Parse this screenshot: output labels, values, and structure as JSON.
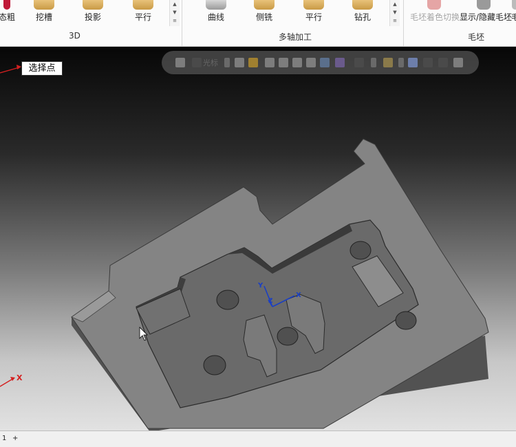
{
  "ribbon": {
    "group_3d": {
      "title": "3D",
      "buttons": [
        "态粗",
        "挖槽",
        "投影",
        "平行"
      ]
    },
    "group_multiaxis": {
      "title": "多轴加工",
      "buttons": [
        "曲线",
        "侧铣",
        "平行",
        "钻孔"
      ]
    },
    "group_stock": {
      "title": "毛坯",
      "buttons": [
        "毛坯着色切换",
        "显示/隐藏毛坯",
        "毛"
      ]
    }
  },
  "viewport": {
    "point_label": "选择点",
    "toolbar": {
      "cursor_label": "光标"
    },
    "axis_labels": {
      "x": "X",
      "y": "Y",
      "z": "Z"
    },
    "colors": {
      "axis_red": "#d42020",
      "gnomon_blue": "#1a3fc4"
    }
  },
  "statusbar": {
    "sheet": "1",
    "add_sheet": "+"
  }
}
